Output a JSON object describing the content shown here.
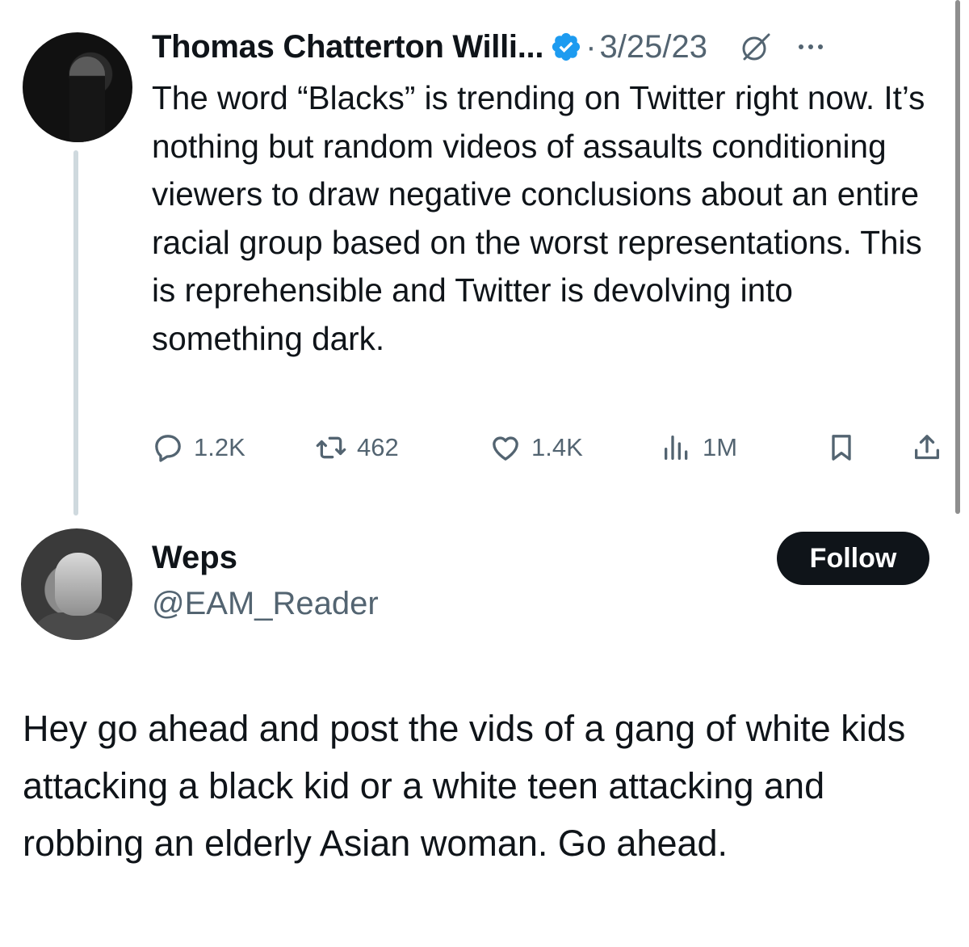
{
  "tweet": {
    "author_name": "Thomas Chatterton Willi...",
    "separator": "·",
    "date": "3/25/23",
    "text": "The word “Blacks” is trending on Twitter right now. It’s nothing but random videos of assaults conditioning viewers to draw negative conclusions about an entire racial group based on the worst representations. This is reprehensible and Twitter is devolving into something dark.",
    "stats": {
      "replies": "1.2K",
      "reposts": "462",
      "likes": "1.4K",
      "views": "1M"
    },
    "icons": [
      "verified-badge-icon",
      "grok-icon",
      "more-icon",
      "reply-icon",
      "repost-icon",
      "like-icon",
      "views-icon",
      "bookmark-icon",
      "share-icon"
    ]
  },
  "reply": {
    "author_name": "Weps",
    "handle": "@EAM_Reader",
    "follow_label": "Follow",
    "text": "Hey go ahead and post the vids of a gang of white kids attacking a black kid or a white teen attacking and robbing an elderly Asian woman. Go ahead."
  },
  "colors": {
    "text_primary": "#0f1419",
    "text_secondary": "#536471",
    "verified_blue": "#1d9bf0",
    "thread_line": "#cfd9de",
    "follow_bg": "#0f1419",
    "follow_text": "#ffffff"
  }
}
